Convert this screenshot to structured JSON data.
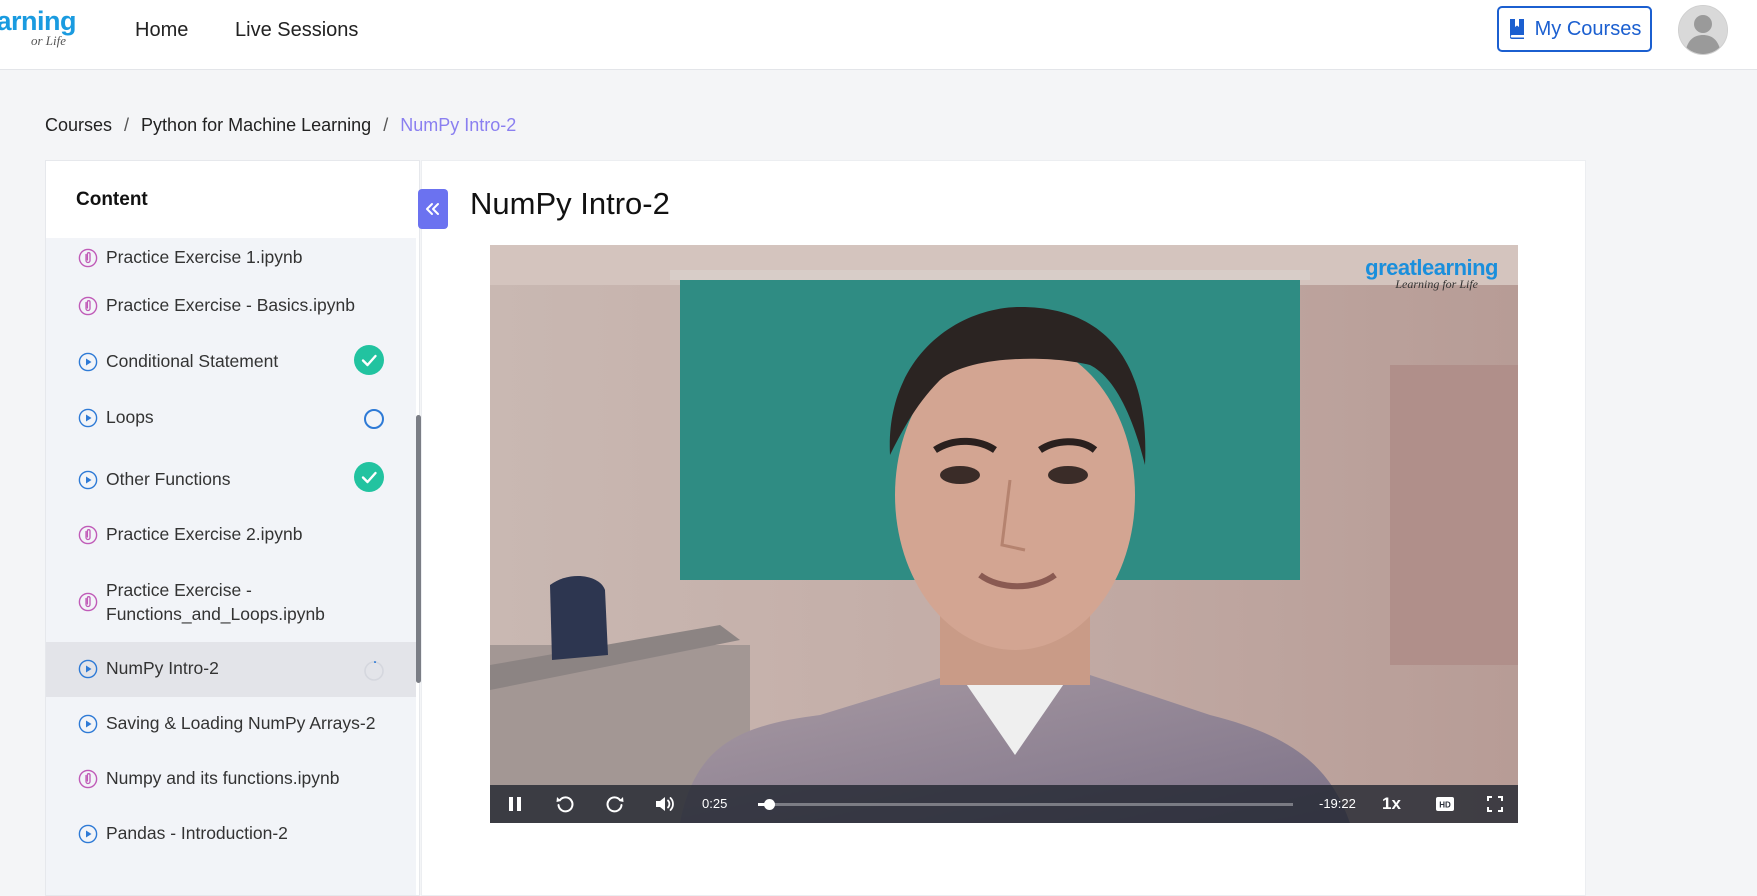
{
  "logo": {
    "line1": "arning",
    "line2": "or Life"
  },
  "nav": {
    "home": "Home",
    "live_sessions": "Live Sessions"
  },
  "header": {
    "my_courses": "My Courses"
  },
  "breadcrumb": {
    "items": [
      "Courses",
      "Python for Machine Learning"
    ],
    "current": "NumPy Intro-2",
    "separator": "/"
  },
  "sidebar": {
    "title": "Content",
    "items": [
      {
        "label": "Practice Exercise 1.ipynb",
        "type": "attachment",
        "status": "none"
      },
      {
        "label": "Practice Exercise - Basics.ipynb",
        "type": "attachment",
        "status": "none"
      },
      {
        "label": "Conditional Statement",
        "type": "video",
        "status": "completed"
      },
      {
        "label": "Loops",
        "type": "video",
        "status": "not-started"
      },
      {
        "label": "Other Functions",
        "type": "video",
        "status": "completed"
      },
      {
        "label": "Practice Exercise 2.ipynb",
        "type": "attachment",
        "status": "none"
      },
      {
        "label": "Practice Exercise - Functions_and_Loops.ipynb",
        "line1": "Practice Exercise -",
        "line2": "Functions_and_Loops.ipynb",
        "type": "attachment",
        "status": "none"
      },
      {
        "label": "NumPy Intro-2",
        "type": "video",
        "status": "in-progress",
        "active": true
      },
      {
        "label": "Saving & Loading NumPy Arrays-2",
        "type": "video",
        "status": "none"
      },
      {
        "label": "Numpy and its functions.ipynb",
        "type": "attachment",
        "status": "none"
      },
      {
        "label": "Pandas - Introduction-2",
        "type": "video",
        "status": "none"
      }
    ]
  },
  "lesson": {
    "title": "NumPy Intro-2"
  },
  "video": {
    "watermark_line1": "greatlearning",
    "watermark_line2": "Learning for Life",
    "elapsed": "0:25",
    "remaining": "-19:22",
    "progress": 0.02,
    "speed": "1x",
    "quality_badge": "HD"
  },
  "colors": {
    "accent": "#1b5fd0",
    "breadcrumb_current": "#8a7ff0",
    "collapse_button": "#6b72f0",
    "completed": "#22c3a0",
    "video_icon": "#2e7ad6",
    "attachment_icon": "#c05bb8"
  },
  "icons": {
    "collapse": "double-chevron-left-icon",
    "attachment": "paperclip-icon",
    "video": "play-circle-icon",
    "completed": "check-circle-icon"
  }
}
